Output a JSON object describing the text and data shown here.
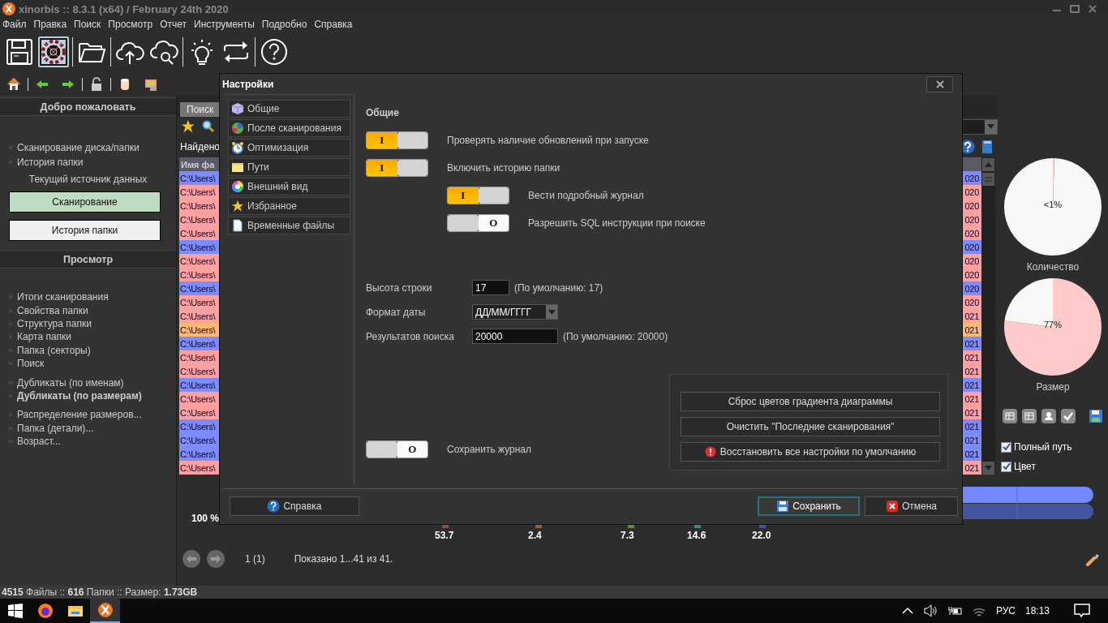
{
  "window": {
    "title": "xinorbis :: 8.3.1 (x64) / February 24th 2020"
  },
  "menu": [
    "Файл",
    "Правка",
    "Поиск",
    "Просмотр",
    "Отчет",
    "Инструменты",
    "Подробно",
    "Справка"
  ],
  "toolbar": [
    [
      {
        "kind": "save",
        "selected": false
      },
      {
        "kind": "gear",
        "selected": true
      }
    ],
    [
      {
        "kind": "folder",
        "selected": false
      }
    ],
    [
      {
        "kind": "cloud-upload",
        "selected": false
      },
      {
        "kind": "cloud-search",
        "selected": false
      }
    ],
    [
      {
        "kind": "bulb",
        "selected": false
      },
      {
        "kind": "swap",
        "selected": false
      }
    ],
    [
      {
        "kind": "help",
        "selected": false
      }
    ]
  ],
  "small_toolbar": [
    [
      {
        "kind": "home"
      }
    ],
    [
      {
        "kind": "back"
      },
      {
        "kind": "forward"
      }
    ],
    [
      {
        "kind": "lock"
      }
    ],
    [
      {
        "kind": "database"
      },
      {
        "kind": "network"
      }
    ]
  ],
  "sidebar": {
    "welcome": {
      "title": "Добро пожаловать",
      "links": [
        "Сканирование диска/папки",
        "История папки"
      ],
      "source_label": "Текущий источник данных",
      "sources": [
        {
          "label": "Сканирование",
          "selected": true
        },
        {
          "label": "История папки",
          "selected": false
        }
      ]
    },
    "view": {
      "title": "Просмотр",
      "groups": [
        [
          {
            "label": "Итоги сканирования",
            "selected": false
          },
          {
            "label": "Свойства папки",
            "selected": false
          },
          {
            "label": "Структура папки",
            "selected": false
          },
          {
            "label": "Карта папки",
            "selected": false
          },
          {
            "label": "Папка (секторы)",
            "selected": false
          },
          {
            "label": "Поиск",
            "selected": false
          }
        ],
        [
          {
            "label": "Дубликаты (по именам)",
            "selected": false
          },
          {
            "label": "Дубликаты (по размерам)",
            "selected": true
          }
        ],
        [
          {
            "label": "Распределение размеров...",
            "selected": false
          },
          {
            "label": "Папка (детали)...",
            "selected": false
          },
          {
            "label": "Возраст...",
            "selected": false
          }
        ]
      ]
    }
  },
  "results": {
    "tab": {
      "label": "Поиск",
      "selected": true
    },
    "found_label": "Найдено",
    "table": {
      "columns": [
        "Имя фа"
      ],
      "rows": [
        {
          "cells": [
            "C:\\Users\\",
            "020"
          ],
          "color": "#7b8cff"
        },
        {
          "cells": [
            "C:\\Users\\",
            "020"
          ],
          "color": "#ffa0a0"
        },
        {
          "cells": [
            "C:\\Users\\",
            "020"
          ],
          "color": "#ffa0a0"
        },
        {
          "cells": [
            "C:\\Users\\",
            "020"
          ],
          "color": "#ffa0a0"
        },
        {
          "cells": [
            "C:\\Users\\",
            "020"
          ],
          "color": "#ffa0a0"
        },
        {
          "cells": [
            "C:\\Users\\",
            "020"
          ],
          "color": "#7b8cff"
        },
        {
          "cells": [
            "C:\\Users\\",
            "020"
          ],
          "color": "#ffa0a0"
        },
        {
          "cells": [
            "C:\\Users\\",
            "020"
          ],
          "color": "#ffa0a0"
        },
        {
          "cells": [
            "C:\\Users\\",
            "020"
          ],
          "color": "#7b8cff"
        },
        {
          "cells": [
            "C:\\Users\\",
            "020"
          ],
          "color": "#ffa0a0"
        },
        {
          "cells": [
            "C:\\Users\\",
            "021"
          ],
          "color": "#ffa0a0"
        },
        {
          "cells": [
            "C:\\Users\\",
            "021"
          ],
          "color": "#ffb870"
        },
        {
          "cells": [
            "C:\\Users\\",
            "021"
          ],
          "color": "#7b8cff"
        },
        {
          "cells": [
            "C:\\Users\\",
            "021"
          ],
          "color": "#ffa0a0"
        },
        {
          "cells": [
            "C:\\Users\\",
            "021"
          ],
          "color": "#ffa0a0"
        },
        {
          "cells": [
            "C:\\Users\\",
            "021"
          ],
          "color": "#7b8cff"
        },
        {
          "cells": [
            "C:\\Users\\",
            "021"
          ],
          "color": "#ffa0a0"
        },
        {
          "cells": [
            "C:\\Users\\",
            "021"
          ],
          "color": "#ffa0a0"
        },
        {
          "cells": [
            "C:\\Users\\",
            "021"
          ],
          "color": "#7b8cff"
        },
        {
          "cells": [
            "C:\\Users\\",
            "021"
          ],
          "color": "#7b8cff"
        },
        {
          "cells": [
            "C:\\Users\\",
            "021"
          ],
          "color": "#7b8cff"
        },
        {
          "cells": [
            "C:\\Users\\",
            "021"
          ],
          "color": "#ffa0a0"
        }
      ]
    }
  },
  "side_panel": {
    "charts": [
      {
        "chart_data": {
          "type": "pie",
          "title": "Количество",
          "values": [
            0.5,
            99.5
          ],
          "value_labels": [
            "<1%",
            null
          ]
        }
      },
      {
        "chart_data": {
          "type": "pie",
          "title": "Размер",
          "values": [
            77,
            23
          ],
          "value_labels": [
            "77%",
            null
          ]
        }
      }
    ],
    "tools": [
      {
        "kind": "table"
      },
      {
        "kind": "table"
      },
      {
        "kind": "user"
      },
      {
        "kind": "check"
      },
      {
        "kind": "save"
      }
    ],
    "options": [
      {
        "label": "Полный путь",
        "checked": true
      },
      {
        "label": "Цвет",
        "checked": true
      }
    ]
  },
  "summary": {
    "percent": "100 %",
    "legend": [
      {
        "value": "53.7",
        "color": "#8c4f4f"
      },
      {
        "value": "2.4",
        "color": "#8a6444"
      },
      {
        "value": "7.3",
        "color": "#5f8a3c"
      },
      {
        "value": "14.6",
        "color": "#3f8a82"
      },
      {
        "value": "22.0",
        "color": "#4653a0"
      }
    ],
    "page": "1 (1)",
    "shown": "Показано 1...41 из 41."
  },
  "status_bar": "**4515** Файлы :: **616** Папки :: Размер: **1.73GB**",
  "taskbar": {
    "apps": [
      {
        "kind": "browser",
        "selected": false
      },
      {
        "kind": "folder",
        "selected": false
      },
      {
        "kind": "xinorbis",
        "selected": true
      }
    ],
    "language": "РУС",
    "time": "18:13"
  },
  "dialog": {
    "title": "Настройки",
    "nav": [
      {
        "label": "Общие",
        "kind": "cube"
      },
      {
        "label": "После сканирования",
        "kind": "chart"
      },
      {
        "label": "Оптимизация",
        "kind": "clock"
      },
      {
        "label": "Пути",
        "kind": "folder"
      },
      {
        "label": "Внешний вид",
        "kind": "palette"
      },
      {
        "label": "Избранное",
        "kind": "star"
      },
      {
        "label": "Временные файлы",
        "kind": "page"
      }
    ],
    "heading": "Общие",
    "toggles": [
      {
        "label": "Проверять наличие обновлений при запуске",
        "on": true,
        "mark": "I"
      },
      {
        "label": "Включить историю папки",
        "on": true,
        "mark": "I",
        "children": [
          {
            "label": "Вести подробный журнал",
            "on": true,
            "mark": "I"
          },
          {
            "label": "Разрешить SQL инструкции при поиске",
            "on": false,
            "mark": "O"
          }
        ]
      }
    ],
    "fields": [
      {
        "kind": "number",
        "label": "Высота строки",
        "value": "17",
        "hint": "(По умолчанию: 17)"
      },
      {
        "kind": "select",
        "label": "Формат даты",
        "value": "ДД/ММ/ГГГГ"
      },
      {
        "kind": "text",
        "label": "Результатов поиска",
        "value": "20000",
        "hint": "(По умолчанию: 20000)"
      }
    ],
    "log_toggle": {
      "label": "Сохранить журнал",
      "on": false,
      "mark": "O"
    },
    "actions": [
      {
        "label": "Сброс цветов градиента диаграммы",
        "kind": "plain"
      },
      {
        "label": "Очистить \"Последние сканирования\"",
        "kind": "plain"
      },
      {
        "label": "Восстановить все настройки по умолчанию",
        "kind": "warning"
      }
    ],
    "footer": [
      {
        "label": "Справка",
        "kind": "help",
        "focused": false
      },
      {
        "label": "Сохранить",
        "kind": "save",
        "focused": true
      },
      {
        "label": "Отмена",
        "kind": "cancel",
        "focused": false
      }
    ]
  }
}
